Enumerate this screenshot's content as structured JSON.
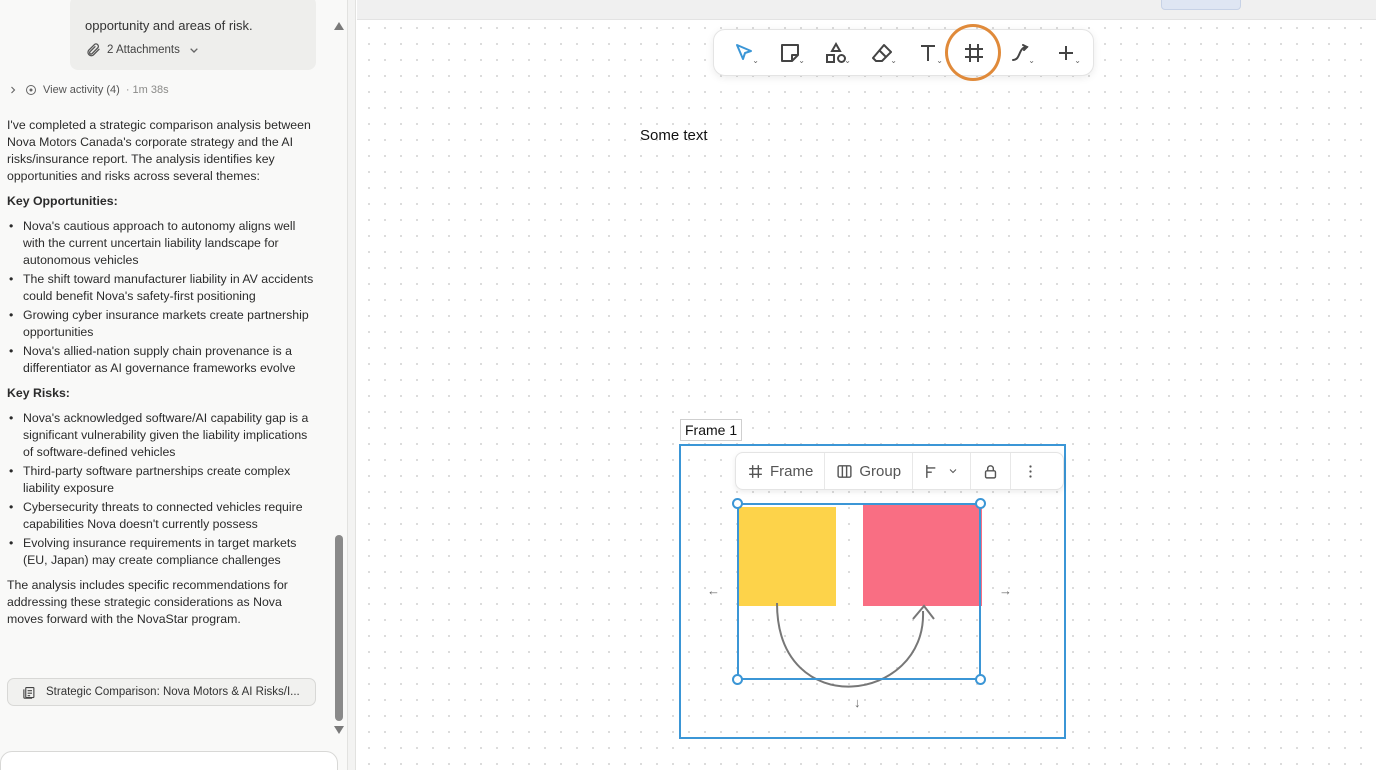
{
  "chat": {
    "prev_message_tail": "opportunity and areas of risk.",
    "attachments_label": "2 Attachments",
    "activity_label": "View activity (4)",
    "activity_time": "· 1m 38s",
    "intro": "I've completed a strategic comparison analysis between Nova Motors Canada's corporate strategy and the AI risks/insurance report. The analysis identifies key opportunities and risks across several themes:",
    "opportunities_heading": "Key Opportunities:",
    "opportunities": [
      "Nova's cautious approach to autonomy aligns well with the current uncertain liability landscape for autonomous vehicles",
      "The shift toward manufacturer liability in AV accidents could benefit Nova's safety-first positioning",
      "Growing cyber insurance markets create partnership opportunities",
      "Nova's allied-nation supply chain provenance is a differentiator as AI governance frameworks evolve"
    ],
    "risks_heading": "Key Risks:",
    "risks": [
      "Nova's acknowledged software/AI capability gap is a significant vulnerability given the liability implications of software-defined vehicles",
      "Third-party software partnerships create complex liability exposure",
      "Cybersecurity threats to connected vehicles require capabilities Nova doesn't currently possess",
      "Evolving insurance requirements in target markets (EU, Japan) may create compliance challenges"
    ],
    "closing": "The analysis includes specific recommendations for addressing these strategic considerations as Nova moves forward with the NovaStar program.",
    "artifact_title": "Strategic Comparison: Nova Motors & AI Risks/I..."
  },
  "toolbar": {
    "tools": [
      {
        "name": "select-tool",
        "icon": "cursor-icon"
      },
      {
        "name": "note-tool",
        "icon": "sticky-note-icon"
      },
      {
        "name": "shapes-tool",
        "icon": "shapes-icon"
      },
      {
        "name": "eraser-tool",
        "icon": "eraser-icon"
      },
      {
        "name": "text-tool",
        "icon": "text-icon"
      },
      {
        "name": "frame-tool",
        "icon": "frame-hash-icon"
      },
      {
        "name": "connector-tool",
        "icon": "connector-icon"
      },
      {
        "name": "add-tool",
        "icon": "plus-icon"
      }
    ],
    "active_color": "#3b96d6",
    "highlight_color": "#e08a3a"
  },
  "canvas": {
    "text_item": "Some text",
    "frame_label": "Frame 1",
    "selection_toolbar": {
      "frame_label": "Frame",
      "group_label": "Group"
    },
    "shape_colors": {
      "yellow": "#fdd34a",
      "red": "#f96e83",
      "selection": "#3b96d6"
    },
    "nudge_arrows": {
      "left": "←",
      "right": "→",
      "down": "↓"
    }
  }
}
